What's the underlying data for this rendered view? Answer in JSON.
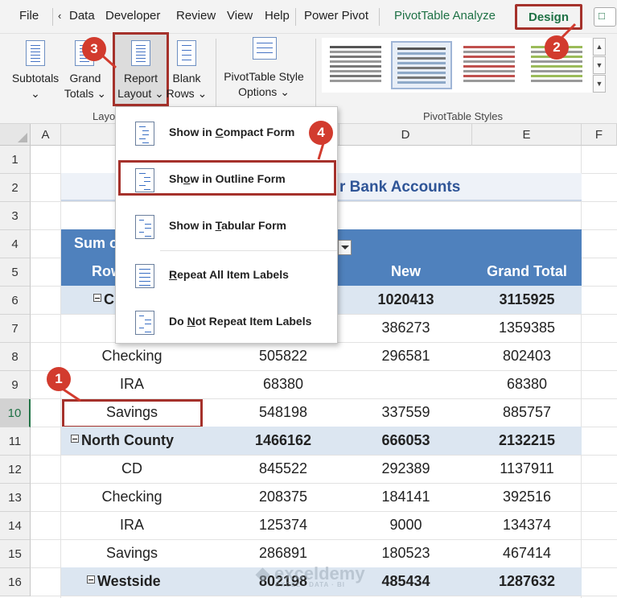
{
  "menubar": {
    "file": "File",
    "scroll_left": "‹",
    "tabs": [
      "Data",
      "Developer",
      "Review",
      "View",
      "Help",
      "Power Pivot"
    ],
    "pivot_analyze": "PivotTable Analyze",
    "design": "Design"
  },
  "ribbon": {
    "subtotals": [
      "Subtotals",
      "⌄"
    ],
    "grand_totals": [
      "Grand",
      "Totals ⌄"
    ],
    "report_layout": [
      "Report",
      "Layout ⌄"
    ],
    "blank_rows": [
      "Blank",
      "Rows ⌄"
    ],
    "style_options": [
      "PivotTable Style",
      "Options ⌄"
    ],
    "layout_group_label": "Layo",
    "styles_group_label": "PivotTable Styles"
  },
  "dropdown": {
    "items": [
      {
        "label": "Show in Compact Form",
        "accel": "C"
      },
      {
        "label": "Show in Outline Form",
        "accel": "o"
      },
      {
        "label": "Show in Tabular Form",
        "accel": "T"
      },
      {
        "label": "Repeat All Item Labels",
        "accel": "R"
      },
      {
        "label": "Do Not Repeat Item Labels",
        "accel": "N"
      }
    ]
  },
  "sheet": {
    "columns": [
      "A",
      "",
      "",
      "D",
      "E",
      "F"
    ],
    "rows": [
      "1",
      "2",
      "3",
      "4",
      "5",
      "6",
      "7",
      "8",
      "9",
      "10",
      "11",
      "12",
      "13",
      "14",
      "15",
      "16"
    ],
    "title_fragment": "r Bank Accounts",
    "sum_fragment": "Sum o",
    "row_label_fragment": "Row",
    "header_new": "New",
    "header_grand_total": "Grand Total",
    "r6": {
      "label": "C",
      "new": "1020413",
      "total": "3115925"
    },
    "r7": {
      "new": "386273",
      "total": "1359385"
    },
    "r8": {
      "label": "Checking",
      "b": "505822",
      "new": "296581",
      "total": "802403"
    },
    "r9": {
      "label": "IRA",
      "b": "68380",
      "new": "",
      "total": "68380"
    },
    "r10": {
      "label": "Savings",
      "b": "548198",
      "new": "337559",
      "total": "885757"
    },
    "r11": {
      "label": "North County",
      "b": "1466162",
      "new": "666053",
      "total": "2132215"
    },
    "r12": {
      "label": "CD",
      "b": "845522",
      "new": "292389",
      "total": "1137911"
    },
    "r13": {
      "label": "Checking",
      "b": "208375",
      "new": "184141",
      "total": "392516"
    },
    "r14": {
      "label": "IRA",
      "b": "125374",
      "new": "9000",
      "total": "134374"
    },
    "r15": {
      "label": "Savings",
      "b": "286891",
      "new": "180523",
      "total": "467414"
    },
    "r16": {
      "label": "Westside",
      "b": "802198",
      "new": "485434",
      "total": "1287632"
    }
  },
  "callouts": [
    "1",
    "2",
    "3",
    "4"
  ],
  "watermark": {
    "brand": "exceldemy",
    "tagline": "EXCEL · DATA · BI"
  },
  "colors": {
    "accent_red": "#a5312b",
    "badge_red": "#d23b2e",
    "pivot_header": "#4f81bd",
    "pivot_band": "#dce6f1",
    "excel_green": "#1e7145"
  }
}
